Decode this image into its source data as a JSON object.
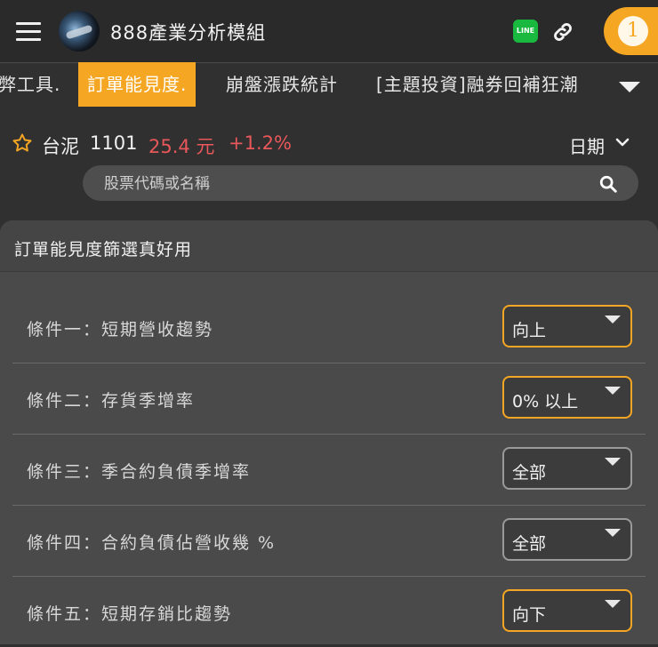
{
  "header": {
    "title": "888產業分析模組",
    "line_label": "LINE",
    "notification_count": "1"
  },
  "tabs": [
    {
      "label": "弊工具."
    },
    {
      "label": "訂單能見度."
    },
    {
      "label": "崩盤漲跌統計"
    },
    {
      "label": "[主題投資]融券回補狂潮"
    }
  ],
  "quote": {
    "name": "台泥",
    "code": "1101",
    "price": "25.4 元",
    "change": "+1.2%",
    "date_label": "日期"
  },
  "search": {
    "placeholder": "股票代碼或名稱"
  },
  "panel": {
    "title": "訂單能見度篩選真好用",
    "conditions": [
      {
        "label": "條件一：短期營收趨勢",
        "value": "向上"
      },
      {
        "label": "條件二：存貨季增率",
        "value": "0% 以上"
      },
      {
        "label": "條件三：季合約負債季增率",
        "value": "全部"
      },
      {
        "label": "條件四：合約負債佔營收幾 %",
        "value": "全部"
      },
      {
        "label": "條件五：短期存銷比趨勢",
        "value": "向下"
      }
    ]
  },
  "colors": {
    "accent": "#f5a623",
    "price_up": "#e8575a",
    "line_green": "#19b93f"
  }
}
